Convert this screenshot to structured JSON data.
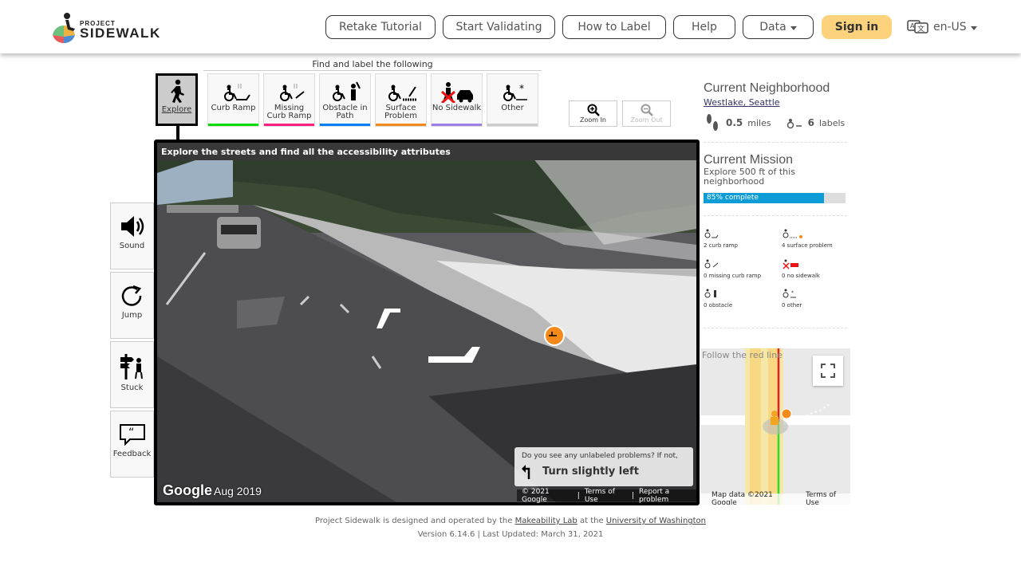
{
  "header": {
    "logo_project": "PROJECT",
    "logo_sidewalk": "SIDEWALK",
    "nav": [
      "Retake Tutorial",
      "Start Validating",
      "How to Label",
      "Help",
      "Data"
    ],
    "signin": "Sign in",
    "language": "en-US"
  },
  "toolbar": {
    "find_label": "Find and label the following",
    "explore_label": "Explore",
    "tools": [
      {
        "label": "Curb Ramp",
        "color": "#00dd00"
      },
      {
        "label": "Missing Curb Ramp",
        "color": "#ff1f7e"
      },
      {
        "label": "Obstacle in Path",
        "color": "#0080ff"
      },
      {
        "label": "Surface Problem",
        "color": "#f58a1b"
      },
      {
        "label": "No Sidewalk",
        "color": "#9c7ee6"
      },
      {
        "label": "Other",
        "color": "#cccccc"
      }
    ],
    "zoom_in": "Zoom In",
    "zoom_out": "Zoom Out"
  },
  "side_controls": [
    "Sound",
    "Jump",
    "Stuck",
    "Feedback"
  ],
  "panorama": {
    "message": "Explore the streets and find all the accessibility attributes",
    "hint_question": "Do you see any unlabeled problems? If not,",
    "hint_action": "Turn slightly left",
    "google": "Google",
    "date": "Aug 2019",
    "footer": [
      "© 2021 Google",
      "Terms of Use",
      "Report a problem"
    ]
  },
  "neighborhood": {
    "title": "Current Neighborhood",
    "name": "Westlake, Seattle",
    "miles": "0.5",
    "miles_unit": "miles",
    "labels": "6",
    "labels_unit": "labels"
  },
  "mission": {
    "title": "Current Mission",
    "description": "Explore 500 ft of this neighborhood",
    "progress_text": "85% complete",
    "progress": 0.85
  },
  "label_counts": [
    {
      "text": "2 curb ramp"
    },
    {
      "text": "4 surface problem"
    },
    {
      "text": "0 missing curb ramp"
    },
    {
      "text": "0 no sidewalk"
    },
    {
      "text": "0 obstacle"
    },
    {
      "text": "0 other"
    }
  ],
  "minimap": {
    "hint": "Follow the red line",
    "footer_data": "Map data ©2021 Google",
    "footer_terms": "Terms of Use"
  },
  "footer": {
    "line1_a": "Project Sidewalk is designed and operated by the",
    "line1_link1": "Makeability Lab",
    "line1_b": "at the",
    "line1_link2": "University of Washington",
    "line2": "Version 6.14.6 | Last Updated: March 31, 2021"
  },
  "colors": {
    "signin_bg": "#fcd27d",
    "progress_fill": "#0d9cd6",
    "route_red": "#e22222",
    "route_green": "#2ddc2d"
  }
}
